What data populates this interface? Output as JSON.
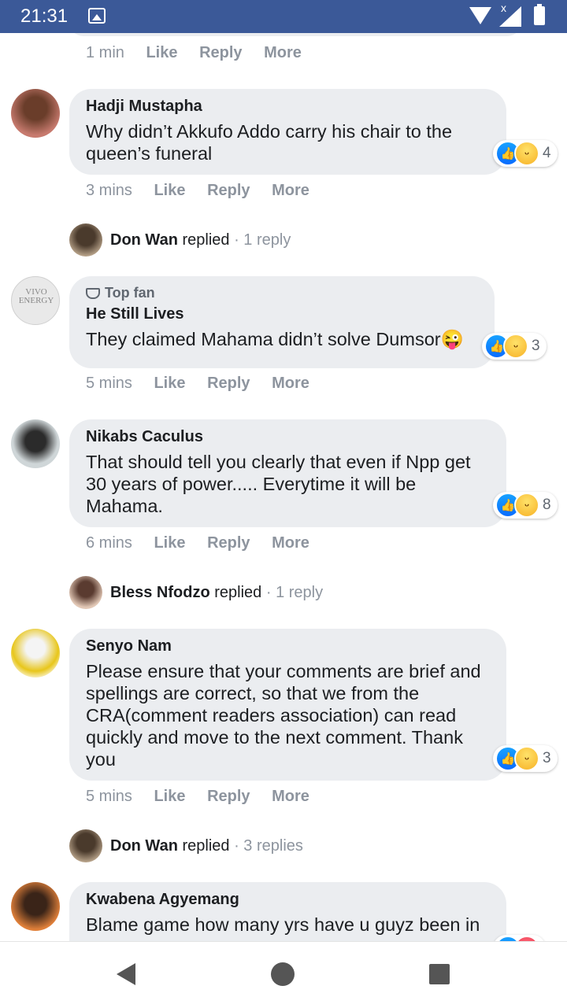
{
  "status": {
    "time": "21:31"
  },
  "first_meta": {
    "time": "1 min",
    "like": "Like",
    "reply": "Reply",
    "more": "More"
  },
  "comments": [
    {
      "author": "Hadji Mustapha",
      "text": "Why didn’t Akkufo Addo carry his chair to the queen’s funeral",
      "time": "3 mins",
      "reactions": "4"
    },
    {
      "badge": "Top fan",
      "author": "He Still Lives",
      "text": "They claimed Mahama didn’t solve Dumsor😜",
      "time": "5 mins",
      "reactions": "3",
      "avatar_text": "VIVO ENERGY"
    },
    {
      "author": "Nikabs Caculus",
      "text": "That should tell you clearly that even if Npp get 30 years of power..... Everytime it will be Mahama.",
      "time": "6 mins",
      "reactions": "8"
    },
    {
      "author": "Senyo Nam",
      "text": "Please ensure that your comments are brief and spellings are correct, so that we from the CRA(comment readers association) can read quickly and move to the next comment. Thank you",
      "time": "5 mins",
      "reactions": "3"
    },
    {
      "author": "Kwabena Agyemang",
      "text": "Blame game how many yrs have u guyz been in"
    }
  ],
  "replies": [
    {
      "name": "Don Wan",
      "verb": "replied",
      "count": "· 1 reply"
    },
    {
      "name": "Bless Nfodzo",
      "verb": "replied",
      "count": "· 1 reply"
    },
    {
      "name": "Don Wan",
      "verb": "replied",
      "count": "· 3 replies"
    }
  ],
  "actions": {
    "like": "Like",
    "reply": "Reply",
    "more": "More"
  }
}
